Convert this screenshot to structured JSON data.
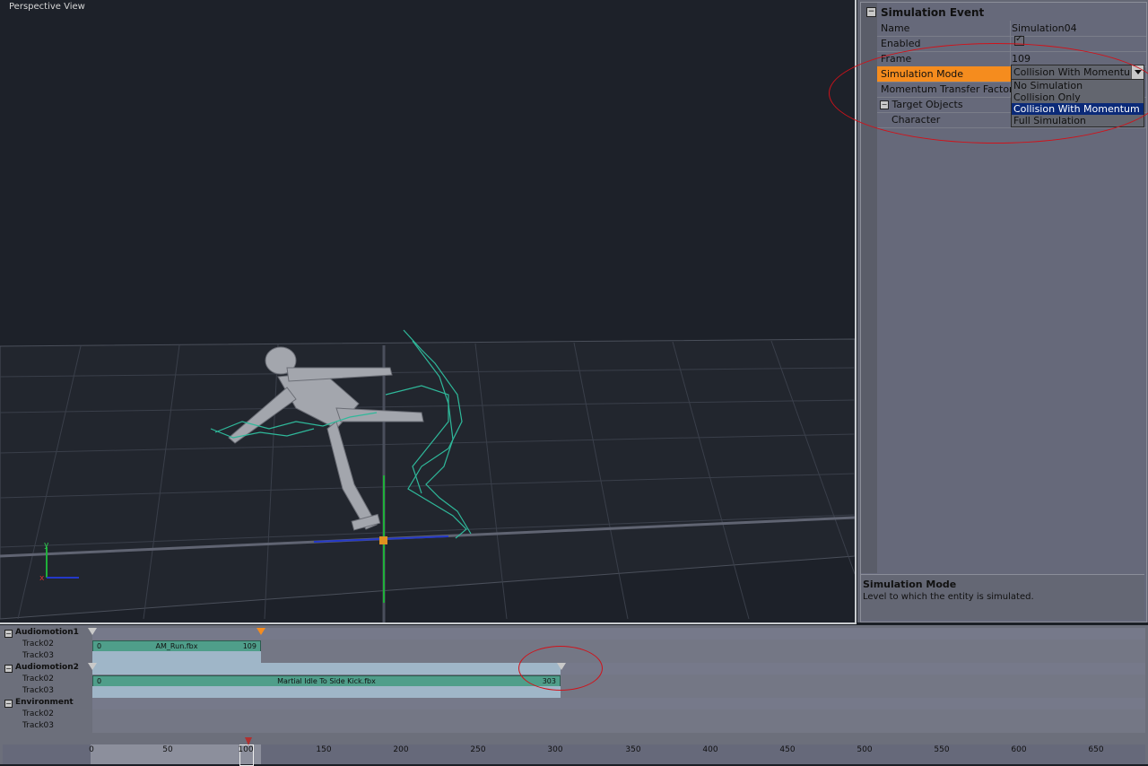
{
  "viewport": {
    "title": "Perspective View"
  },
  "panel": {
    "section_title": "Simulation Event",
    "rows": {
      "name": {
        "label": "Name",
        "value": "Simulation04"
      },
      "enabled": {
        "label": "Enabled"
      },
      "frame": {
        "label": "Frame",
        "value": "109"
      },
      "sim_mode": {
        "label": "Simulation Mode",
        "value": "Collision With Momentum"
      },
      "momentum": {
        "label": "Momentum Transfer Factor"
      },
      "target": {
        "label": "Target Objects"
      },
      "character": {
        "label": "Character"
      }
    },
    "dropdown_options": [
      "No Simulation",
      "Collision Only",
      "Collision With Momentum",
      "Full Simulation"
    ],
    "help": {
      "title": "Simulation Mode",
      "desc": "Level to which the entity is simulated."
    }
  },
  "timeline": {
    "groups": [
      {
        "name": "Audiomotion1",
        "tracks": [
          "Track02",
          "Track03"
        ]
      },
      {
        "name": "Audiomotion2",
        "tracks": [
          "Track02",
          "Track03"
        ]
      },
      {
        "name": "Environment",
        "tracks": [
          "Track02",
          "Track03"
        ]
      }
    ],
    "clips": {
      "clip1": {
        "start": "0",
        "name": "AM_Run.fbx",
        "end": "109"
      },
      "clip2": {
        "start": "0",
        "name": "Martial Idle To Side Kick.fbx",
        "end": "303"
      }
    },
    "ruler_ticks": [
      "0",
      "50",
      "100",
      "150",
      "200",
      "250",
      "300",
      "350",
      "400",
      "450",
      "500",
      "550",
      "600",
      "650"
    ]
  },
  "colors": {
    "accent": "#f58c1e",
    "clip": "#4f9e8a",
    "highlight_circle": "#d0121a",
    "selection": "#0b2a78"
  }
}
